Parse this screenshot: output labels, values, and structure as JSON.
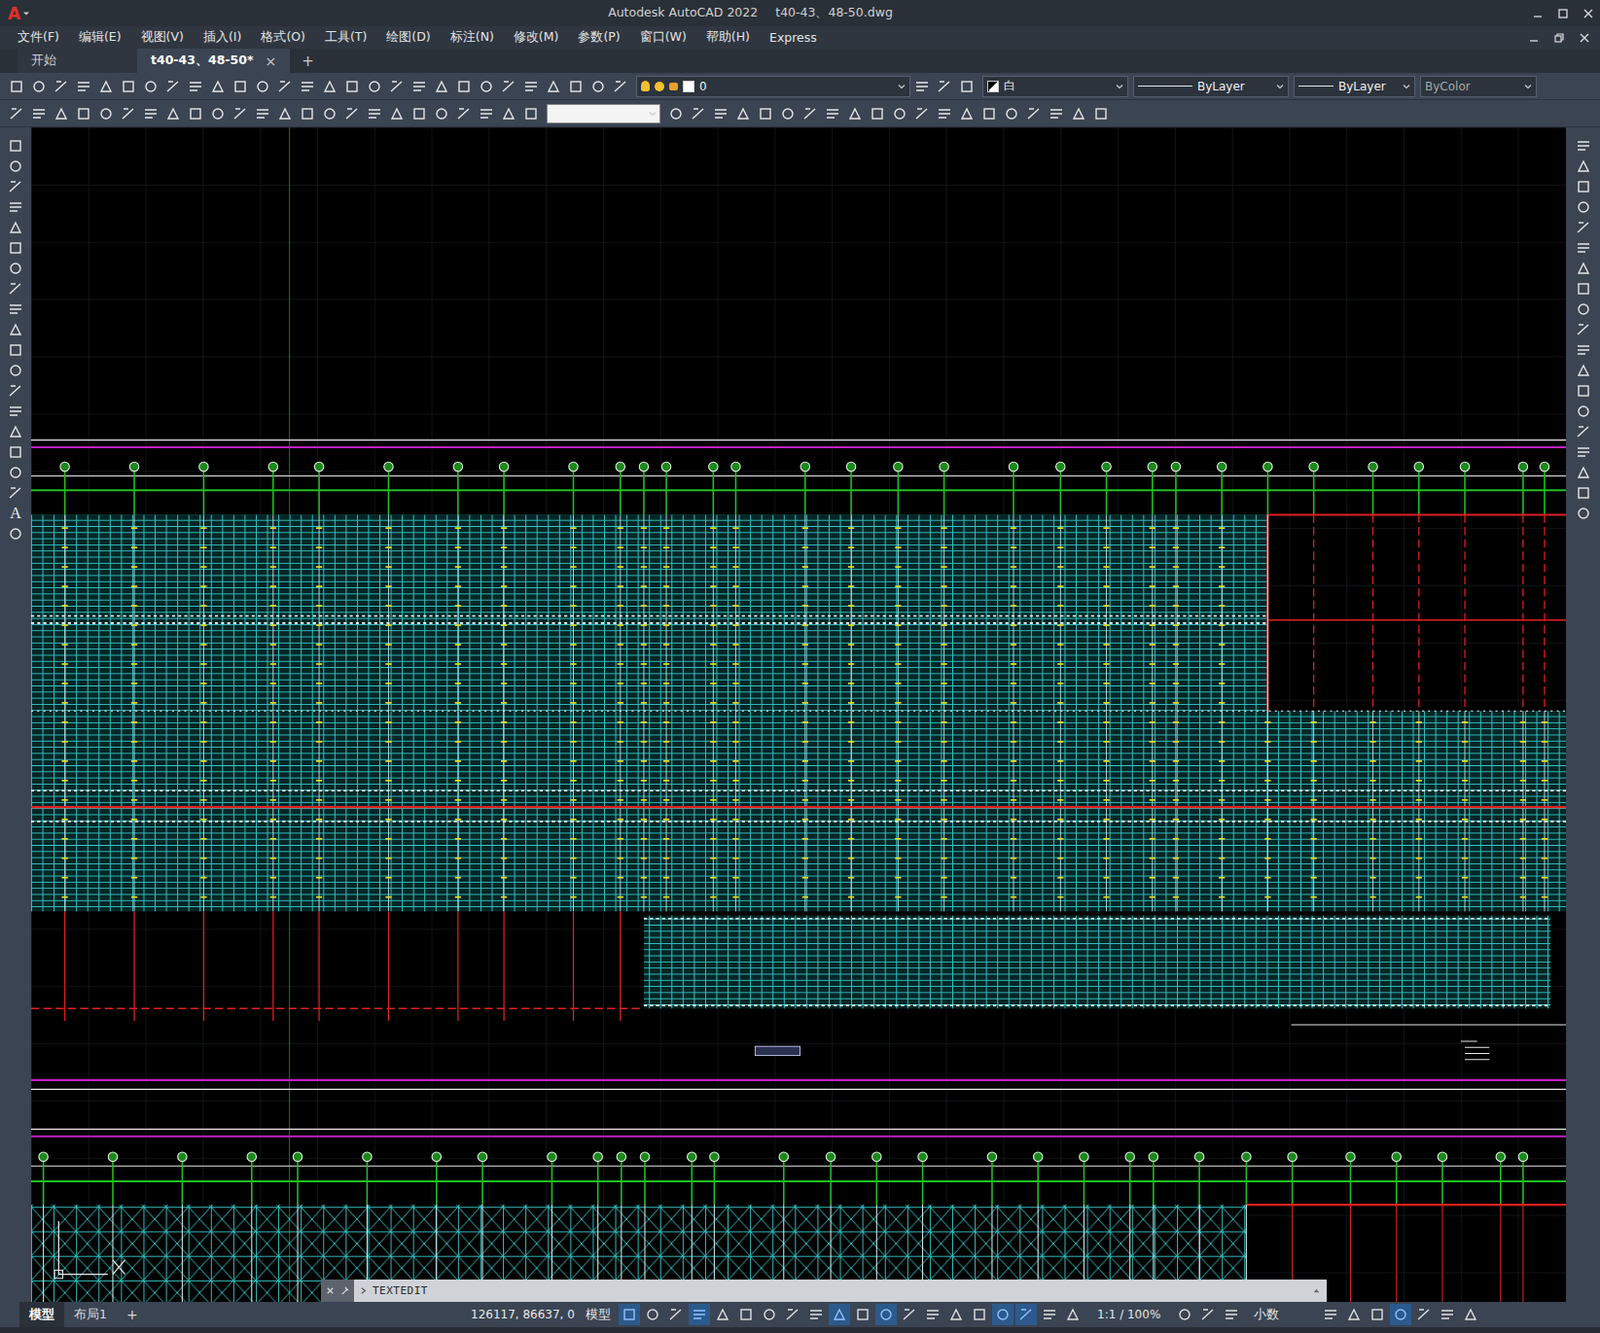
{
  "window": {
    "logo": "A",
    "app": "Autodesk AutoCAD 2022",
    "file": "t40-43、48-50.dwg"
  },
  "menus": [
    "文件(F)",
    "编辑(E)",
    "视图(V)",
    "插入(I)",
    "格式(O)",
    "工具(T)",
    "绘图(D)",
    "标注(N)",
    "修改(M)",
    "参数(P)",
    "窗口(W)",
    "帮助(H)",
    "Express"
  ],
  "doc_tabs": [
    {
      "label": "开始",
      "selected": false,
      "closable": false
    },
    {
      "label": "t40-43、48-50*",
      "selected": true,
      "closable": true
    }
  ],
  "new_tab": "+",
  "close_glyph": "×",
  "properties": {
    "layer": "0",
    "color": "白",
    "linetype": "ByLayer",
    "lineweight": "ByLayer",
    "plotstyle": "ByColor"
  },
  "left_toolbar": {
    "text_tool": "A"
  },
  "command_line": {
    "text": "TEXTEDIT"
  },
  "layout_tabs": [
    {
      "label": "模型",
      "selected": true
    },
    {
      "label": "布局1",
      "selected": false
    }
  ],
  "add_layout": "+",
  "status_bar": {
    "coordinates": "126117, 86637, 0",
    "space": "模型",
    "scale": "1:1 / 100%",
    "units": "小数",
    "toggles_a": [
      {
        "on": true
      },
      {
        "on": false
      },
      {
        "on": false
      },
      {
        "on": true
      },
      {
        "on": false
      },
      {
        "on": false
      },
      {
        "on": false
      },
      {
        "on": false
      },
      {
        "on": false
      },
      {
        "on": true
      },
      {
        "on": false
      },
      {
        "on": true
      },
      {
        "on": false
      },
      {
        "on": false
      },
      {
        "on": false
      },
      {
        "on": false
      },
      {
        "on": true
      },
      {
        "on": true
      },
      {
        "on": false
      },
      {
        "on": false
      }
    ],
    "toggles_b": [
      {
        "on": false
      },
      {
        "on": false
      },
      {
        "on": false
      }
    ],
    "toggles_c": [
      {
        "on": false
      },
      {
        "on": false
      },
      {
        "on": false
      },
      {
        "on": true
      },
      {
        "on": false
      },
      {
        "on": false
      },
      {
        "on": false
      }
    ]
  }
}
